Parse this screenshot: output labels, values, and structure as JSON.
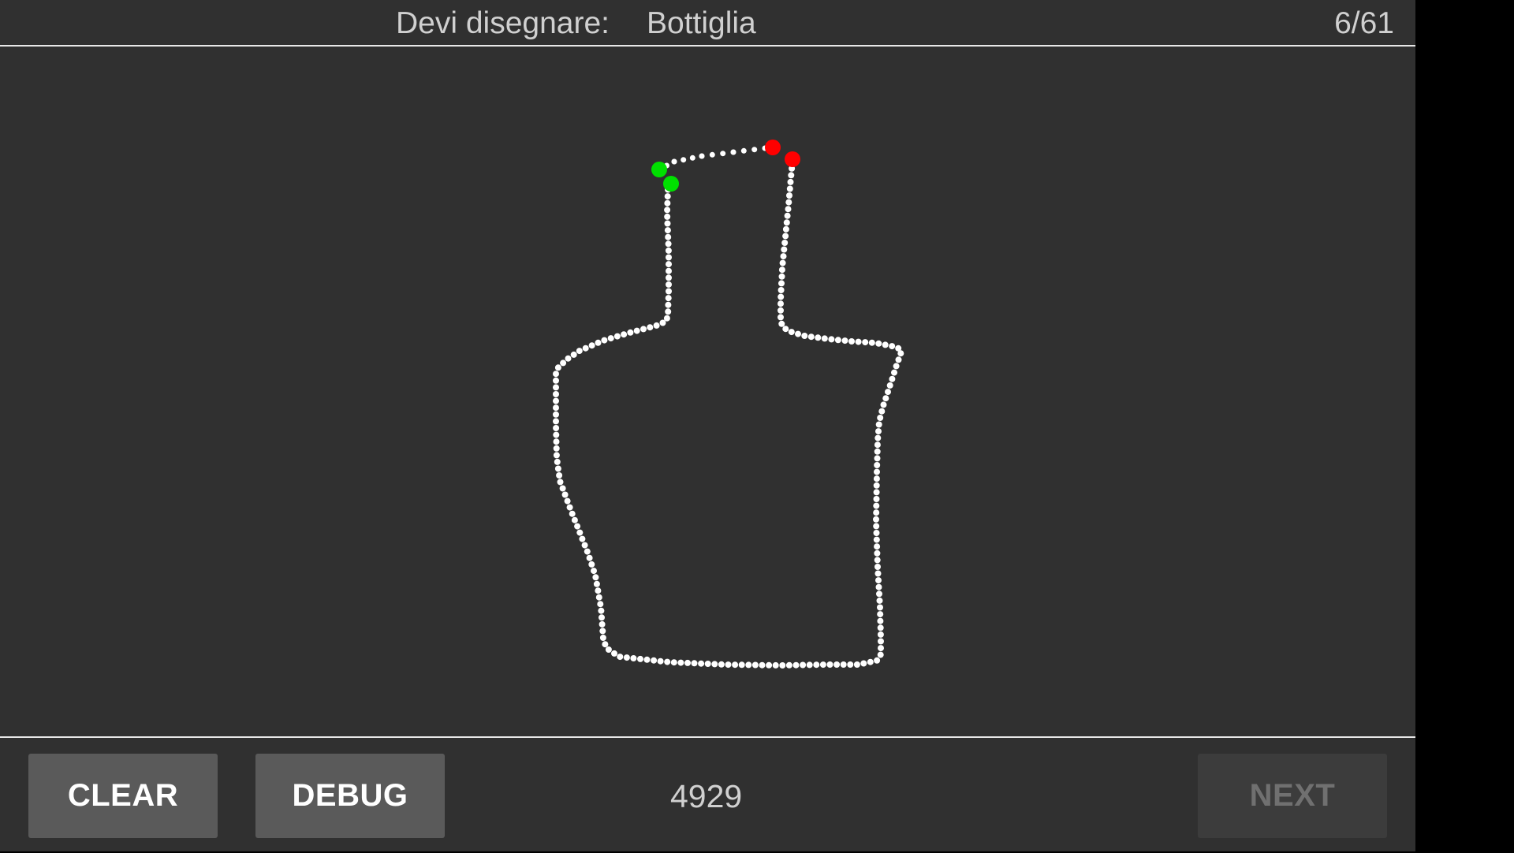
{
  "header": {
    "prompt_label": "Devi disegnare:",
    "prompt_word": "Bottiglia",
    "progress": "6/61"
  },
  "footer": {
    "clear_label": "CLEAR",
    "debug_label": "DEBUG",
    "score": "4929",
    "next_label": "NEXT",
    "next_enabled": false
  },
  "drawing": {
    "stroke_color": "#ffffff",
    "start_marker_color": "#00e000",
    "end_marker_color": "#ff0000"
  },
  "colors": {
    "background": "#303030",
    "button": "#5a5a5a",
    "button_disabled": "#3c3c3c"
  }
}
